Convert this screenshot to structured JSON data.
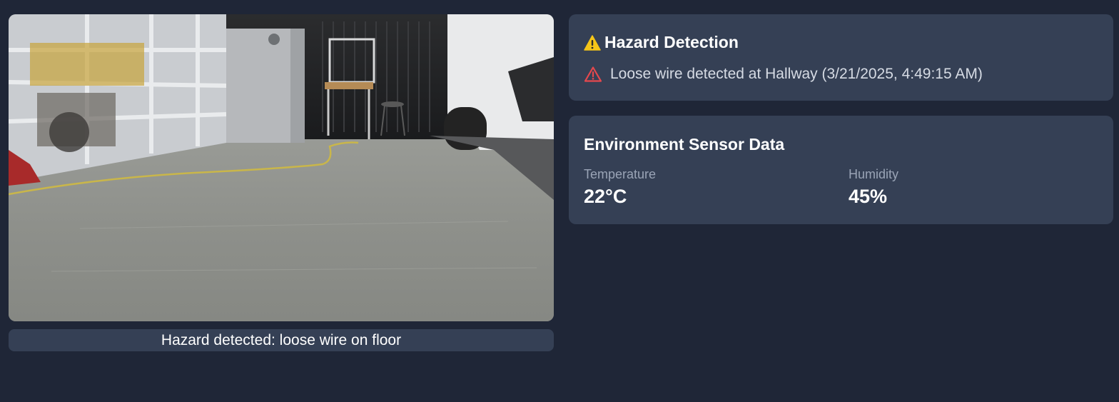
{
  "camera": {
    "caption": "Hazard detected: loose wire on floor"
  },
  "hazard_card": {
    "title": "Hazard Detection",
    "title_icon": "warning-emoji-icon",
    "alerts": [
      {
        "icon": "alert-triangle-icon",
        "text": "Loose wire detected at Hallway (3/21/2025, 4:49:15 AM)"
      }
    ]
  },
  "environment_card": {
    "title": "Environment Sensor Data",
    "temperature": {
      "label": "Temperature",
      "value": "22°C"
    },
    "humidity": {
      "label": "Humidity",
      "value": "45%"
    }
  },
  "colors": {
    "background": "#1f2637",
    "card": "#354055",
    "alert_red": "#e5484d",
    "warning_yellow": "#f5c518",
    "muted_text": "#9aa4b6"
  }
}
